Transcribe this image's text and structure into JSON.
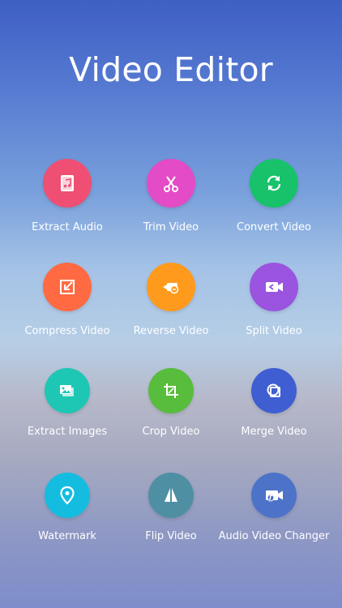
{
  "app": {
    "title": "Video Editor"
  },
  "tools": [
    {
      "label": "Extract Audio",
      "icon": "music-file-icon",
      "color": "#ef4f72"
    },
    {
      "label": "Trim Video",
      "icon": "scissors-icon",
      "color": "#e44bc6"
    },
    {
      "label": "Convert Video",
      "icon": "refresh-icon",
      "color": "#17c26a"
    },
    {
      "label": "Compress Video",
      "icon": "compress-icon",
      "color": "#ff6a42"
    },
    {
      "label": "Reverse Video",
      "icon": "reverse-camera-icon",
      "color": "#ff9a1c"
    },
    {
      "label": "Split Video",
      "icon": "split-camera-icon",
      "color": "#9a54e0"
    },
    {
      "label": "Extract Images",
      "icon": "images-icon",
      "color": "#1ec7b4"
    },
    {
      "label": "Crop Video",
      "icon": "crop-icon",
      "color": "#58bc3c"
    },
    {
      "label": "Merge Video",
      "icon": "merge-icon",
      "color": "#3f5ed1"
    },
    {
      "label": "Watermark",
      "icon": "location-pin-icon",
      "color": "#14bde0"
    },
    {
      "label": "Flip Video",
      "icon": "flip-icon",
      "color": "#4f8fa4"
    },
    {
      "label": "Audio Video Changer",
      "icon": "video-audio-icon",
      "color": "#4d73c9"
    }
  ]
}
